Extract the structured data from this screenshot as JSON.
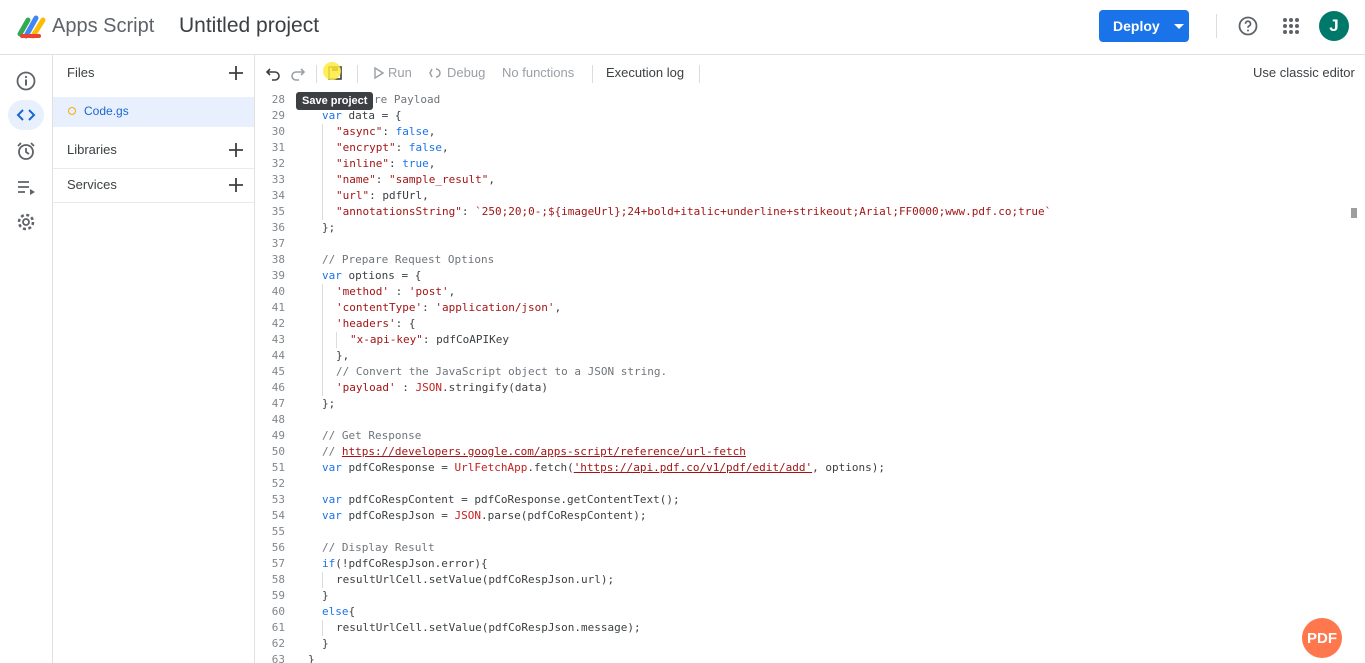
{
  "header": {
    "app_name": "Apps Script",
    "project_title": "Untitled project",
    "deploy_label": "Deploy",
    "avatar_initial": "J"
  },
  "sidebar": {
    "files_label": "Files",
    "file_name": "Code.gs",
    "libraries_label": "Libraries",
    "services_label": "Services"
  },
  "toolbar": {
    "run_label": "Run",
    "debug_label": "Debug",
    "function_select": "No functions",
    "execution_log_label": "Execution log",
    "classic_editor_label": "Use classic editor",
    "save_tooltip": "Save project"
  },
  "watermark": "PDF",
  "colors": {
    "accent": "#1a73e8",
    "avatar": "#00796b",
    "keyword": "#1a73e8",
    "string": "#a31515",
    "comment": "#70757a"
  },
  "code": {
    "lines": [
      {
        "n": "28",
        "segs": [
          {
            "t": "re Payload",
            "c": "c"
          }
        ],
        "indent": 1
      },
      {
        "n": "29",
        "segs": [
          {
            "t": "var ",
            "c": "k"
          },
          {
            "t": "data = {",
            "c": ""
          }
        ],
        "indent": 0
      },
      {
        "n": "30",
        "segs": [
          {
            "t": "\"async\"",
            "c": "s"
          },
          {
            "t": ": ",
            "c": ""
          },
          {
            "t": "false",
            "c": "k"
          },
          {
            "t": ",",
            "c": ""
          }
        ],
        "indent": 1
      },
      {
        "n": "31",
        "segs": [
          {
            "t": "\"encrypt\"",
            "c": "s"
          },
          {
            "t": ": ",
            "c": ""
          },
          {
            "t": "false",
            "c": "k"
          },
          {
            "t": ",",
            "c": ""
          }
        ],
        "indent": 1
      },
      {
        "n": "32",
        "segs": [
          {
            "t": "\"inline\"",
            "c": "s"
          },
          {
            "t": ": ",
            "c": ""
          },
          {
            "t": "true",
            "c": "k"
          },
          {
            "t": ",",
            "c": ""
          }
        ],
        "indent": 1
      },
      {
        "n": "33",
        "segs": [
          {
            "t": "\"name\"",
            "c": "s"
          },
          {
            "t": ": ",
            "c": ""
          },
          {
            "t": "\"sample_result\"",
            "c": "s"
          },
          {
            "t": ",",
            "c": ""
          }
        ],
        "indent": 1
      },
      {
        "n": "34",
        "segs": [
          {
            "t": "\"url\"",
            "c": "s"
          },
          {
            "t": ": pdfUrl,",
            "c": ""
          }
        ],
        "indent": 1
      },
      {
        "n": "35",
        "segs": [
          {
            "t": "\"annotationsString\"",
            "c": "s"
          },
          {
            "t": ": ",
            "c": ""
          },
          {
            "t": "`250;20;0-;${imageUrl};24+bold+italic+underline+strikeout;Arial;FF0000;www.pdf.co;true`",
            "c": "s"
          }
        ],
        "indent": 1
      },
      {
        "n": "36",
        "segs": [
          {
            "t": "};",
            "c": ""
          }
        ],
        "indent": 0
      },
      {
        "n": "37",
        "segs": [],
        "indent": 0
      },
      {
        "n": "38",
        "segs": [
          {
            "t": "// Prepare Request Options",
            "c": "c"
          }
        ],
        "indent": 0
      },
      {
        "n": "39",
        "segs": [
          {
            "t": "var ",
            "c": "k"
          },
          {
            "t": "options = {",
            "c": ""
          }
        ],
        "indent": 0
      },
      {
        "n": "40",
        "segs": [
          {
            "t": "'method'",
            "c": "s"
          },
          {
            "t": " : ",
            "c": ""
          },
          {
            "t": "'post'",
            "c": "s"
          },
          {
            "t": ",",
            "c": ""
          }
        ],
        "indent": 1
      },
      {
        "n": "41",
        "segs": [
          {
            "t": "'contentType'",
            "c": "s"
          },
          {
            "t": ": ",
            "c": ""
          },
          {
            "t": "'application/json'",
            "c": "s"
          },
          {
            "t": ",",
            "c": ""
          }
        ],
        "indent": 1
      },
      {
        "n": "42",
        "segs": [
          {
            "t": "'headers'",
            "c": "s"
          },
          {
            "t": ": {",
            "c": ""
          }
        ],
        "indent": 1
      },
      {
        "n": "43",
        "segs": [
          {
            "t": "\"x-api-key\"",
            "c": "s"
          },
          {
            "t": ": pdfCoAPIKey",
            "c": ""
          }
        ],
        "indent": 2
      },
      {
        "n": "44",
        "segs": [
          {
            "t": "},",
            "c": ""
          }
        ],
        "indent": 1
      },
      {
        "n": "45",
        "segs": [
          {
            "t": "// Convert the JavaScript object to a JSON string.",
            "c": "c"
          }
        ],
        "indent": 1
      },
      {
        "n": "46",
        "segs": [
          {
            "t": "'payload'",
            "c": "s"
          },
          {
            "t": " : ",
            "c": ""
          },
          {
            "t": "JSON",
            "c": "f"
          },
          {
            "t": ".stringify(data)",
            "c": ""
          }
        ],
        "indent": 1
      },
      {
        "n": "47",
        "segs": [
          {
            "t": "};",
            "c": ""
          }
        ],
        "indent": 0
      },
      {
        "n": "48",
        "segs": [],
        "indent": 0
      },
      {
        "n": "49",
        "segs": [
          {
            "t": "// Get Response",
            "c": "c"
          }
        ],
        "indent": 0
      },
      {
        "n": "50",
        "segs": [
          {
            "t": "// ",
            "c": "c"
          },
          {
            "t": "https://developers.google.com/apps-script/reference/url-fetch",
            "c": "u"
          }
        ],
        "indent": 0
      },
      {
        "n": "51",
        "segs": [
          {
            "t": "var ",
            "c": "k"
          },
          {
            "t": "pdfCoResponse = ",
            "c": ""
          },
          {
            "t": "UrlFetchApp",
            "c": "f"
          },
          {
            "t": ".fetch(",
            "c": ""
          },
          {
            "t": "'https://api.pdf.co/v1/pdf/edit/add'",
            "c": "u"
          },
          {
            "t": ", options);",
            "c": ""
          }
        ],
        "indent": 0
      },
      {
        "n": "52",
        "segs": [],
        "indent": 0
      },
      {
        "n": "53",
        "segs": [
          {
            "t": "var ",
            "c": "k"
          },
          {
            "t": "pdfCoRespContent = pdfCoResponse.getContentText();",
            "c": ""
          }
        ],
        "indent": 0
      },
      {
        "n": "54",
        "segs": [
          {
            "t": "var ",
            "c": "k"
          },
          {
            "t": "pdfCoRespJson = ",
            "c": ""
          },
          {
            "t": "JSON",
            "c": "f"
          },
          {
            "t": ".parse(pdfCoRespContent);",
            "c": ""
          }
        ],
        "indent": 0
      },
      {
        "n": "55",
        "segs": [],
        "indent": 0
      },
      {
        "n": "56",
        "segs": [
          {
            "t": "// Display Result",
            "c": "c"
          }
        ],
        "indent": 0
      },
      {
        "n": "57",
        "segs": [
          {
            "t": "if",
            "c": "k"
          },
          {
            "t": "(!pdfCoRespJson.error){",
            "c": ""
          }
        ],
        "indent": 0
      },
      {
        "n": "58",
        "segs": [
          {
            "t": "resultUrlCell.setValue(pdfCoRespJson.url);",
            "c": ""
          }
        ],
        "indent": 1
      },
      {
        "n": "59",
        "segs": [
          {
            "t": "}",
            "c": ""
          }
        ],
        "indent": 0
      },
      {
        "n": "60",
        "segs": [
          {
            "t": "else",
            "c": "k"
          },
          {
            "t": "{",
            "c": ""
          }
        ],
        "indent": 0
      },
      {
        "n": "61",
        "segs": [
          {
            "t": "resultUrlCell.setValue(pdfCoRespJson.message);",
            "c": ""
          }
        ],
        "indent": 1
      },
      {
        "n": "62",
        "segs": [
          {
            "t": "}",
            "c": ""
          }
        ],
        "indent": 0
      },
      {
        "n": "63",
        "segs": [
          {
            "t": "}",
            "c": ""
          }
        ],
        "indent": -1
      }
    ]
  }
}
